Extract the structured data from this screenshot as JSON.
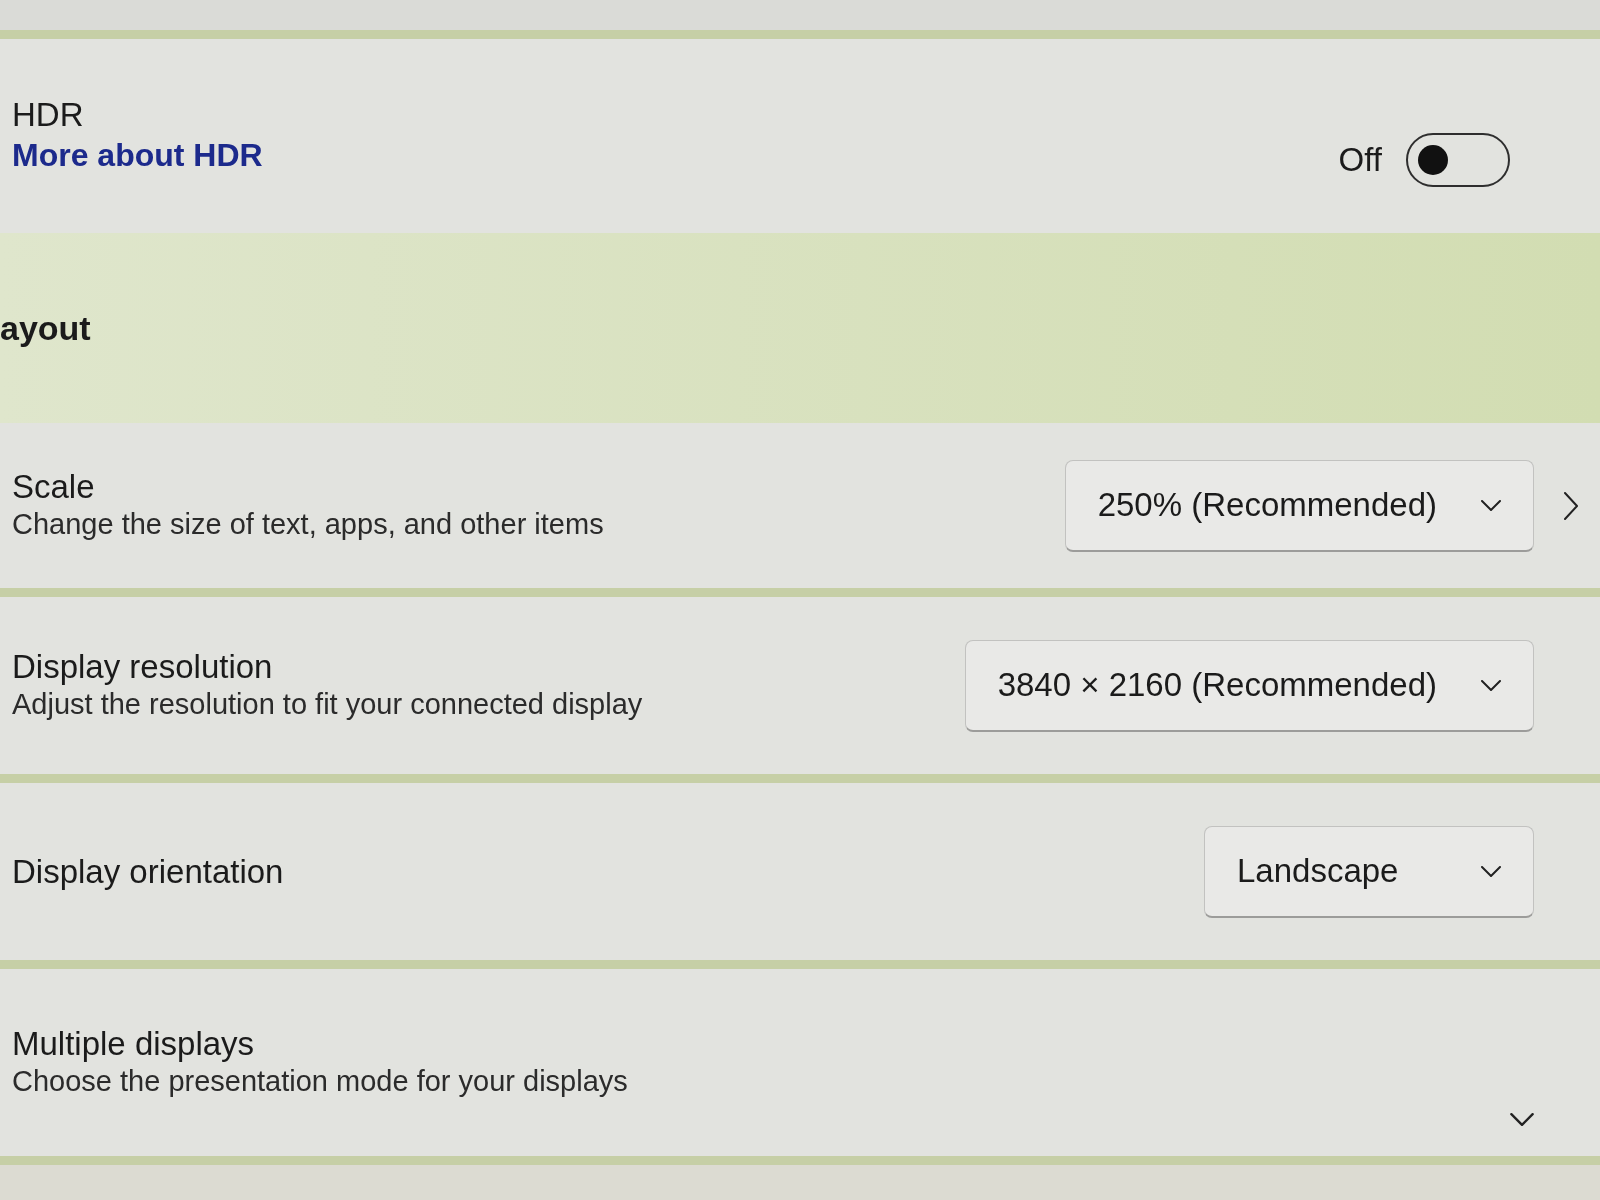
{
  "hdr": {
    "title": "HDR",
    "link": "More about HDR",
    "status": "Off",
    "on": false
  },
  "section": {
    "title": "ayout"
  },
  "settings": [
    {
      "kind": "dropdown",
      "title": "Scale",
      "description": "Change the size of text, apps, and other items",
      "value": "250% (Recommended)",
      "navigates": true
    },
    {
      "kind": "dropdown",
      "title": "Display resolution",
      "description": "Adjust the resolution to fit your connected display",
      "value": "3840 × 2160 (Recommended)"
    },
    {
      "kind": "dropdown",
      "title": "Display orientation",
      "value": "Landscape"
    },
    {
      "kind": "expander",
      "title": "Multiple displays",
      "description": "Choose the presentation mode for your displays",
      "expanded": false
    }
  ]
}
